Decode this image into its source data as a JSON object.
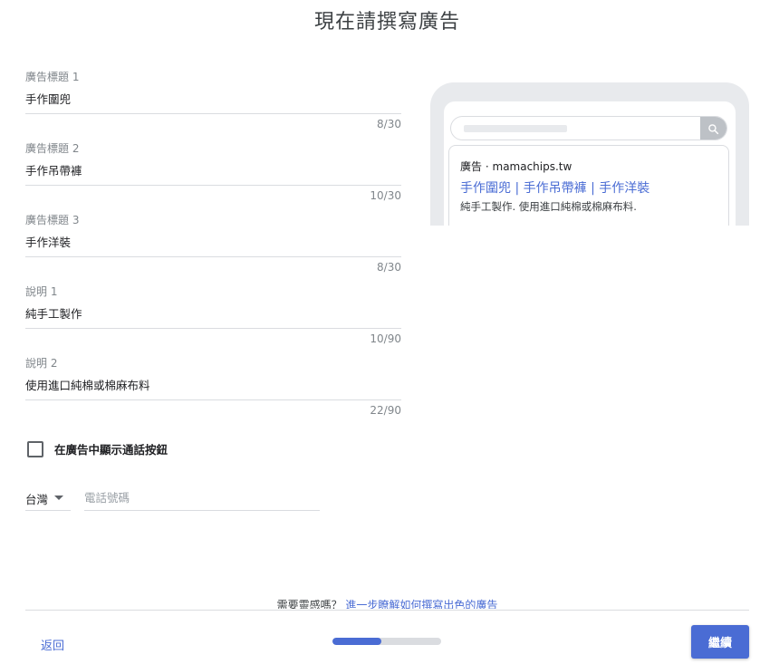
{
  "page": {
    "title": "現在請撰寫廣告"
  },
  "fields": [
    {
      "label": "廣告標題 1",
      "value": "手作圍兜",
      "count": "8/30"
    },
    {
      "label": "廣告標題 2",
      "value": "手作吊帶褲",
      "count": "10/30"
    },
    {
      "label": "廣告標題 3",
      "value": "手作洋裝",
      "count": "8/30"
    },
    {
      "label": "說明 1",
      "value": "純手工製作",
      "count": "10/90"
    },
    {
      "label": "說明 2",
      "value": "使用進口純棉或棉麻布料",
      "count": "22/90"
    }
  ],
  "call_option": {
    "label": "在廣告中顯示通話按鈕",
    "checked": false
  },
  "phone": {
    "country": "台灣",
    "placeholder": "電話號碼",
    "value": ""
  },
  "preview": {
    "ad_label": "廣告",
    "separator": "·",
    "domain": "mamachips.tw",
    "headline": "手作圍兜 | 手作吊帶褲 | 手作洋裝",
    "description": "純手工製作. 使用進口純棉或棉麻布料."
  },
  "footer": {
    "help_prefix": "需要靈感嗎？",
    "help_link": "進一步瞭解如何撰寫出色的廣告",
    "back_label": "返回",
    "continue_label": "繼續",
    "progress_percent": 45
  },
  "colors": {
    "accent": "#4a6cd4",
    "link": "#4a6cd4",
    "divider": "#dadce0"
  },
  "icons": {
    "search": "search-icon",
    "dropdown": "dropdown-arrow-icon",
    "checkbox": "checkbox-unchecked"
  }
}
